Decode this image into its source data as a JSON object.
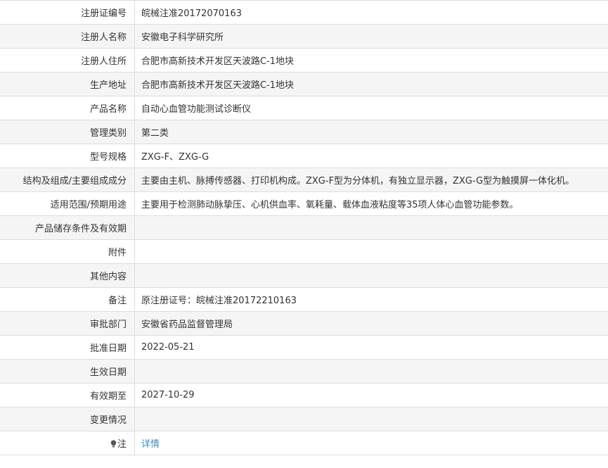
{
  "colors": {
    "link": "#3c8dbc",
    "stripe": "#f5f5f5",
    "border": "#dddddd",
    "text": "#333333"
  },
  "rows": [
    {
      "label": "注册证编号",
      "value": "皖械注准20172070163"
    },
    {
      "label": "注册人名称",
      "value": "安徽电子科学研究所"
    },
    {
      "label": "注册人住所",
      "value": "合肥市高新技术开发区天波路C-1地块"
    },
    {
      "label": "生产地址",
      "value": "合肥市高新技术开发区天波路C-1地块"
    },
    {
      "label": "产品名称",
      "value": "自动心血管功能测试诊断仪"
    },
    {
      "label": "管理类别",
      "value": "第二类"
    },
    {
      "label": "型号规格",
      "value": "ZXG-F、ZXG-G"
    },
    {
      "label": "结构及组成/主要组成成分",
      "value": "主要由主机、脉搏传感器、打印机构成。ZXG-F型为分体机，有独立显示器，ZXG-G型为触摸屏一体化机。"
    },
    {
      "label": "适用范围/预期用途",
      "value": "主要用于检测肺动脉挚压、心机供血率、氧耗量、载体血液粘度等35项人体心血管功能参数。"
    },
    {
      "label": "产品储存条件及有效期",
      "value": ""
    },
    {
      "label": "附件",
      "value": ""
    },
    {
      "label": "其他内容",
      "value": ""
    },
    {
      "label": "备注",
      "value": "原注册证号：皖械注准20172210163"
    },
    {
      "label": "审批部门",
      "value": "安徽省药品监督管理局"
    },
    {
      "label": "批准日期",
      "value": "2022-05-21"
    },
    {
      "label": "生效日期",
      "value": ""
    },
    {
      "label": "有效期至",
      "value": "2027-10-29"
    },
    {
      "label": "变更情况",
      "value": ""
    }
  ],
  "note": {
    "icon": "lightbulb-icon",
    "label": "注",
    "link_text": "详情"
  }
}
